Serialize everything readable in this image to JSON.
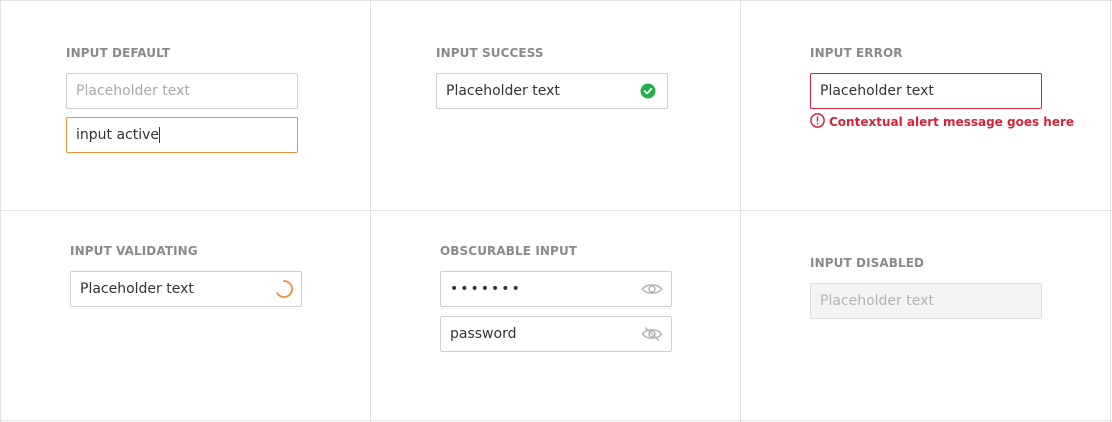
{
  "colors": {
    "accent": "#e8913a",
    "success": "#21b04b",
    "error": "#d0263c",
    "muted": "#8a8a8a"
  },
  "default": {
    "label": "INPUT DEFAULT",
    "placeholder": "Placeholder text",
    "active_value": "input active"
  },
  "success": {
    "label": "INPUT SUCCESS",
    "value": "Placeholder text",
    "icon": "check-circle-icon"
  },
  "error": {
    "label": "INPUT ERROR",
    "value": "Placeholder text",
    "message": "Contextual alert message goes here",
    "icon": "alert-circle-icon"
  },
  "validating": {
    "label": "INPUT VALIDATING",
    "value": "Placeholder text",
    "icon": "spinner-icon"
  },
  "obscurable": {
    "label": "OBSCURABLE INPUT",
    "masked_value": "•••••••",
    "visible_value": "password",
    "show_icon": "eye-icon",
    "hide_icon": "eye-off-icon"
  },
  "disabled": {
    "label": "INPUT DISABLED",
    "placeholder": "Placeholder text"
  }
}
